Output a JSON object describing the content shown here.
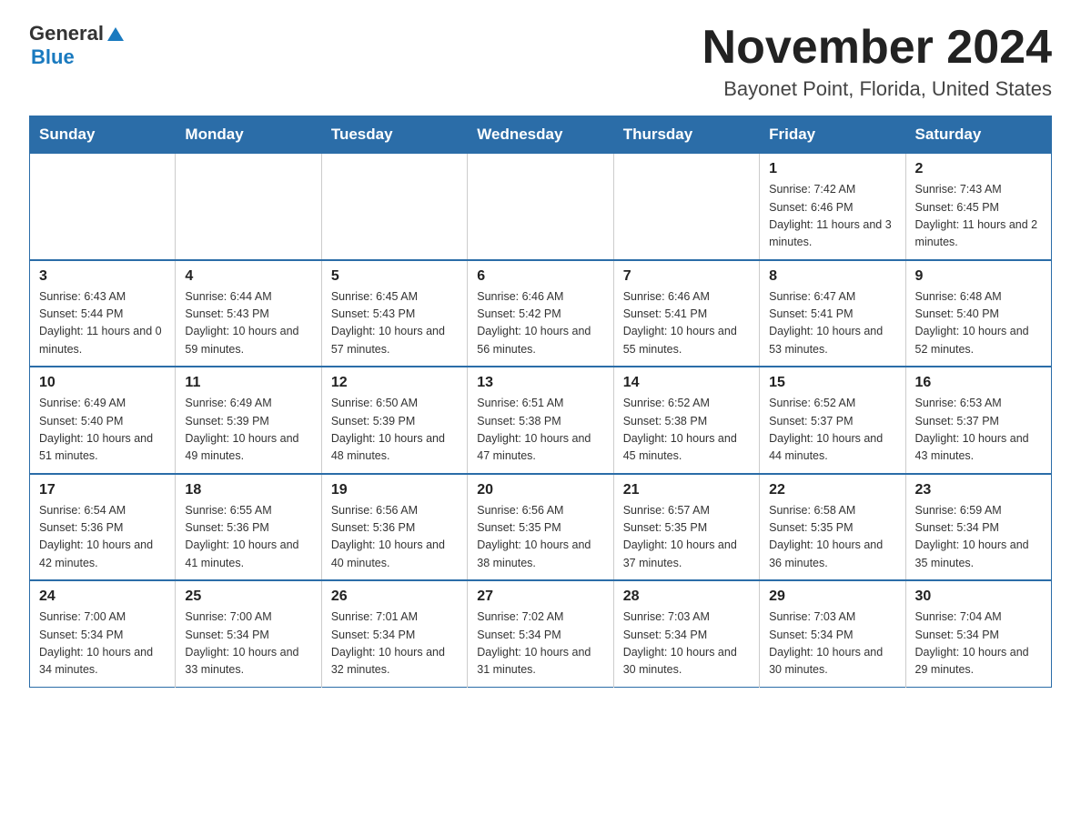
{
  "logo": {
    "general": "General",
    "blue": "Blue",
    "triangle": "▲"
  },
  "title": "November 2024",
  "subtitle": "Bayonet Point, Florida, United States",
  "headers": [
    "Sunday",
    "Monday",
    "Tuesday",
    "Wednesday",
    "Thursday",
    "Friday",
    "Saturday"
  ],
  "weeks": [
    [
      {
        "day": "",
        "info": ""
      },
      {
        "day": "",
        "info": ""
      },
      {
        "day": "",
        "info": ""
      },
      {
        "day": "",
        "info": ""
      },
      {
        "day": "",
        "info": ""
      },
      {
        "day": "1",
        "info": "Sunrise: 7:42 AM\nSunset: 6:46 PM\nDaylight: 11 hours and 3 minutes."
      },
      {
        "day": "2",
        "info": "Sunrise: 7:43 AM\nSunset: 6:45 PM\nDaylight: 11 hours and 2 minutes."
      }
    ],
    [
      {
        "day": "3",
        "info": "Sunrise: 6:43 AM\nSunset: 5:44 PM\nDaylight: 11 hours and 0 minutes."
      },
      {
        "day": "4",
        "info": "Sunrise: 6:44 AM\nSunset: 5:43 PM\nDaylight: 10 hours and 59 minutes."
      },
      {
        "day": "5",
        "info": "Sunrise: 6:45 AM\nSunset: 5:43 PM\nDaylight: 10 hours and 57 minutes."
      },
      {
        "day": "6",
        "info": "Sunrise: 6:46 AM\nSunset: 5:42 PM\nDaylight: 10 hours and 56 minutes."
      },
      {
        "day": "7",
        "info": "Sunrise: 6:46 AM\nSunset: 5:41 PM\nDaylight: 10 hours and 55 minutes."
      },
      {
        "day": "8",
        "info": "Sunrise: 6:47 AM\nSunset: 5:41 PM\nDaylight: 10 hours and 53 minutes."
      },
      {
        "day": "9",
        "info": "Sunrise: 6:48 AM\nSunset: 5:40 PM\nDaylight: 10 hours and 52 minutes."
      }
    ],
    [
      {
        "day": "10",
        "info": "Sunrise: 6:49 AM\nSunset: 5:40 PM\nDaylight: 10 hours and 51 minutes."
      },
      {
        "day": "11",
        "info": "Sunrise: 6:49 AM\nSunset: 5:39 PM\nDaylight: 10 hours and 49 minutes."
      },
      {
        "day": "12",
        "info": "Sunrise: 6:50 AM\nSunset: 5:39 PM\nDaylight: 10 hours and 48 minutes."
      },
      {
        "day": "13",
        "info": "Sunrise: 6:51 AM\nSunset: 5:38 PM\nDaylight: 10 hours and 47 minutes."
      },
      {
        "day": "14",
        "info": "Sunrise: 6:52 AM\nSunset: 5:38 PM\nDaylight: 10 hours and 45 minutes."
      },
      {
        "day": "15",
        "info": "Sunrise: 6:52 AM\nSunset: 5:37 PM\nDaylight: 10 hours and 44 minutes."
      },
      {
        "day": "16",
        "info": "Sunrise: 6:53 AM\nSunset: 5:37 PM\nDaylight: 10 hours and 43 minutes."
      }
    ],
    [
      {
        "day": "17",
        "info": "Sunrise: 6:54 AM\nSunset: 5:36 PM\nDaylight: 10 hours and 42 minutes."
      },
      {
        "day": "18",
        "info": "Sunrise: 6:55 AM\nSunset: 5:36 PM\nDaylight: 10 hours and 41 minutes."
      },
      {
        "day": "19",
        "info": "Sunrise: 6:56 AM\nSunset: 5:36 PM\nDaylight: 10 hours and 40 minutes."
      },
      {
        "day": "20",
        "info": "Sunrise: 6:56 AM\nSunset: 5:35 PM\nDaylight: 10 hours and 38 minutes."
      },
      {
        "day": "21",
        "info": "Sunrise: 6:57 AM\nSunset: 5:35 PM\nDaylight: 10 hours and 37 minutes."
      },
      {
        "day": "22",
        "info": "Sunrise: 6:58 AM\nSunset: 5:35 PM\nDaylight: 10 hours and 36 minutes."
      },
      {
        "day": "23",
        "info": "Sunrise: 6:59 AM\nSunset: 5:34 PM\nDaylight: 10 hours and 35 minutes."
      }
    ],
    [
      {
        "day": "24",
        "info": "Sunrise: 7:00 AM\nSunset: 5:34 PM\nDaylight: 10 hours and 34 minutes."
      },
      {
        "day": "25",
        "info": "Sunrise: 7:00 AM\nSunset: 5:34 PM\nDaylight: 10 hours and 33 minutes."
      },
      {
        "day": "26",
        "info": "Sunrise: 7:01 AM\nSunset: 5:34 PM\nDaylight: 10 hours and 32 minutes."
      },
      {
        "day": "27",
        "info": "Sunrise: 7:02 AM\nSunset: 5:34 PM\nDaylight: 10 hours and 31 minutes."
      },
      {
        "day": "28",
        "info": "Sunrise: 7:03 AM\nSunset: 5:34 PM\nDaylight: 10 hours and 30 minutes."
      },
      {
        "day": "29",
        "info": "Sunrise: 7:03 AM\nSunset: 5:34 PM\nDaylight: 10 hours and 30 minutes."
      },
      {
        "day": "30",
        "info": "Sunrise: 7:04 AM\nSunset: 5:34 PM\nDaylight: 10 hours and 29 minutes."
      }
    ]
  ]
}
